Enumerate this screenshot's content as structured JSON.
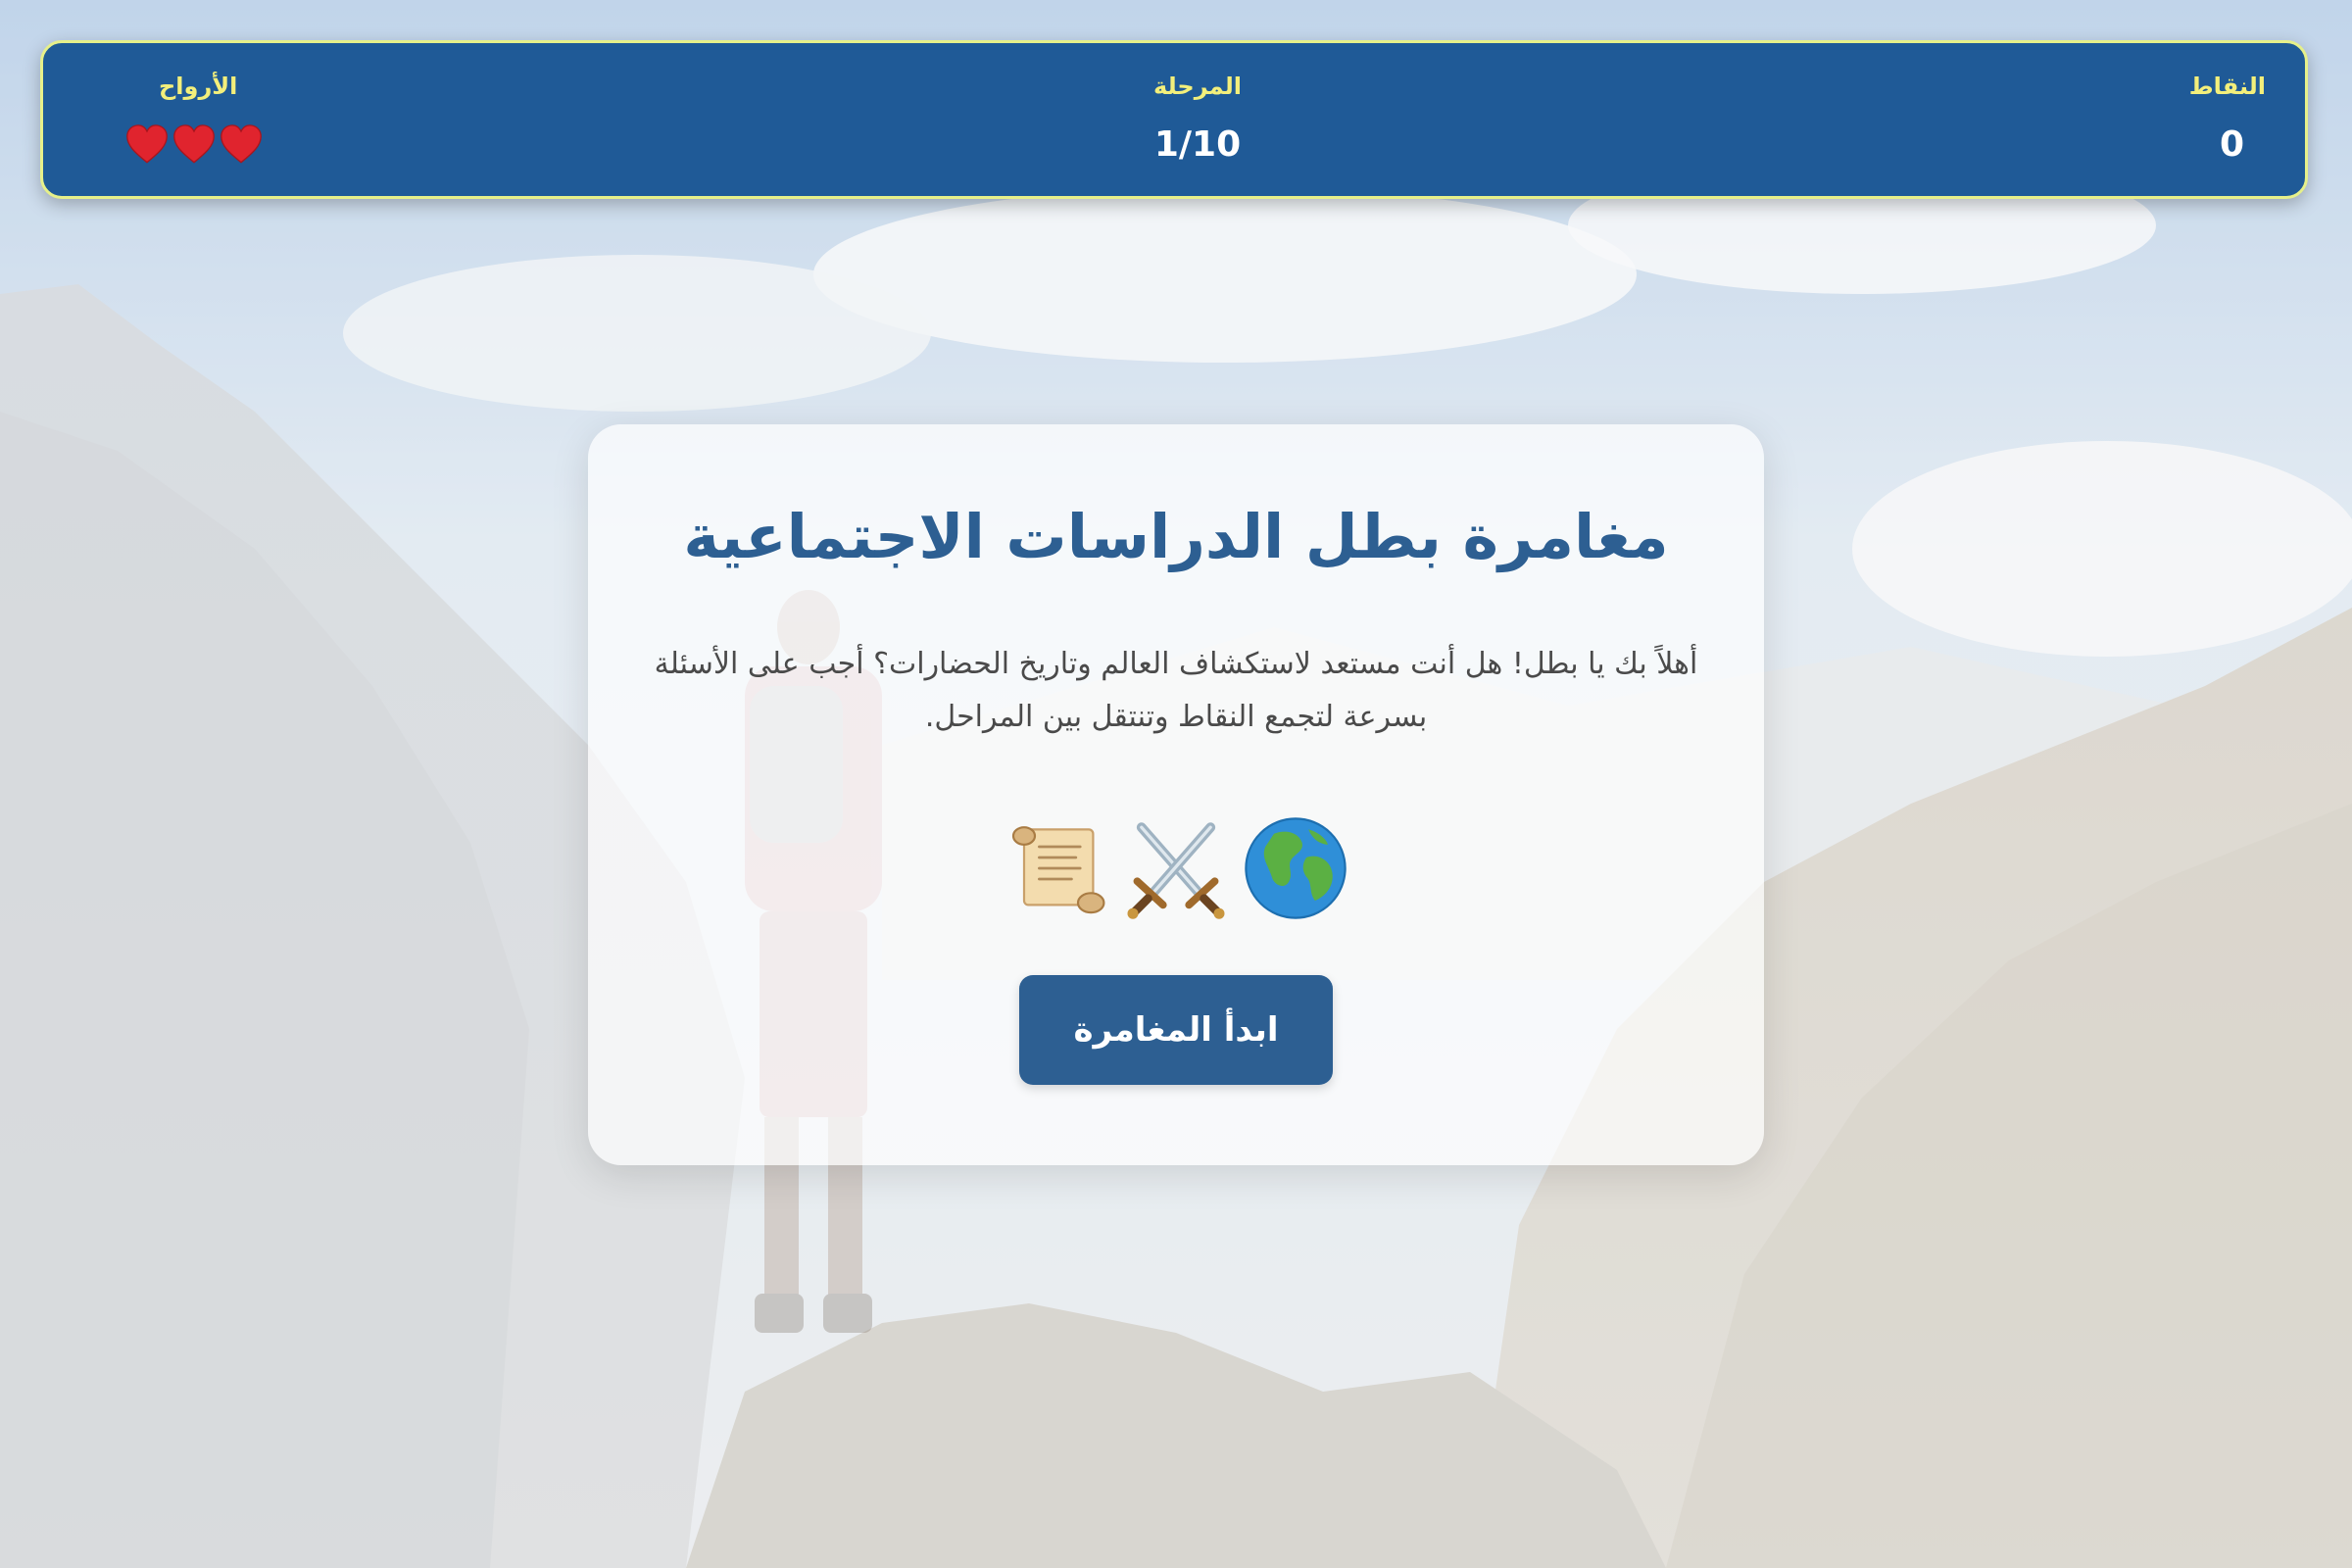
{
  "hud": {
    "score_label": "النقاط",
    "score_value": "0",
    "stage_label": "المرحلة",
    "stage_value": "1/10",
    "lives_label": "الأرواح",
    "lives_count": 3
  },
  "intro": {
    "title": "مغامرة بطل الدراسات الاجتماعية",
    "description": "أهلاً بك يا بطل! هل أنت مستعد لاستكشاف العالم وتاريخ الحضارات؟ أجب على الأسئلة بسرعة لتجمع النقاط وتنتقل بين المراحل.",
    "icons": [
      "globe-icon",
      "crossed-swords-icon",
      "scroll-icon"
    ],
    "start_button_label": "ابدأ المغامرة"
  },
  "colors": {
    "hud_background": "#1f5a97",
    "hud_border": "#e6f08a",
    "hud_label": "#f3ef7b",
    "accent": "#2d5f92",
    "heart": "#e0242e"
  }
}
